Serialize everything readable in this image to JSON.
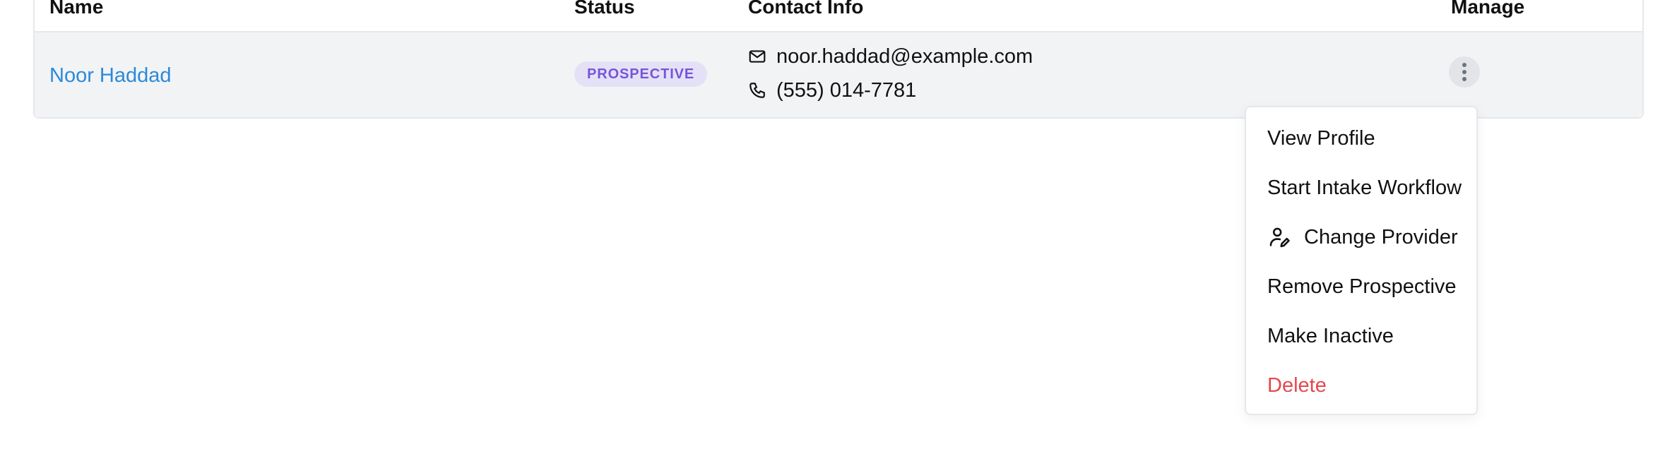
{
  "table": {
    "headers": {
      "name": "Name",
      "status": "Status",
      "contact": "Contact Info",
      "manage": "Manage"
    },
    "rows": [
      {
        "name": "Noor Haddad",
        "status": "PROSPECTIVE",
        "email": "noor.haddad@example.com",
        "phone": "(555) 014-7781",
        "email_icon": "mail-icon",
        "phone_icon": "phone-icon",
        "manage_icon": "more-vertical-icon"
      }
    ]
  },
  "menu": {
    "items": [
      {
        "label": "View Profile"
      },
      {
        "label": "Start Intake Workflow"
      },
      {
        "label": "Change Provider",
        "icon": "user-edit-icon"
      },
      {
        "label": "Remove Prospective"
      },
      {
        "label": "Make Inactive"
      },
      {
        "label": "Delete",
        "variant": "danger"
      }
    ]
  },
  "colors": {
    "link": "#2b8ad8",
    "badge_bg": "#e4e1f7",
    "badge_text": "#7655d8",
    "row_bg": "#f2f3f5",
    "danger": "#e5484d"
  }
}
